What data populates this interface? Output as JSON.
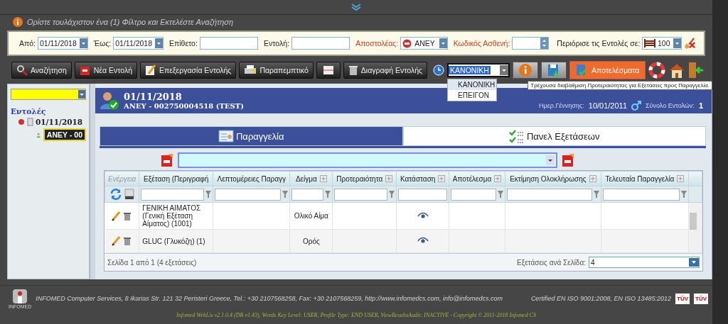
{
  "message": "Ορίστε τουλάχιστον ένα (1) Φίλτρο και Εκτελέστε Αναζήτηση",
  "filters": [
    {
      "kind": "date",
      "label": "Από:",
      "value": "01/11/2018",
      "highlighted": false
    },
    {
      "kind": "date",
      "label": "Έως:",
      "value": "01/11/2018",
      "highlighted": false
    },
    {
      "kind": "text",
      "label": "Επίθετο:",
      "highlighted": false
    },
    {
      "kind": "text",
      "label": "Εντολή:",
      "highlighted": false
    },
    {
      "kind": "select",
      "label": "Αποστολέας:",
      "value": "ΑΝΕΥ",
      "highlighted": true
    },
    {
      "kind": "spinner",
      "label": "Κωδικός Ασθενή:",
      "highlighted": true
    }
  ],
  "limit": {
    "label": "Περιόρισε τις Εντολές σε:",
    "value": "100"
  },
  "toolbar": [
    {
      "kind": "labeled",
      "label": "Αναζήτηση"
    },
    {
      "kind": "labeled",
      "label": "Νέα Εντολή"
    },
    {
      "kind": "labeled",
      "label": "Επεξεργασία Εντολής"
    },
    {
      "kind": "labeled",
      "label": "Παραπεμπτικό"
    },
    {
      "kind": "icon"
    },
    {
      "kind": "labeled",
      "label": "Διαγραφή Εντολής"
    }
  ],
  "priority": {
    "value": "ΚΑΝΟΝΙΚΗ",
    "expanded": true,
    "options": [
      {
        "label": "ΚΑΝΟΝΙΚΗ",
        "selected": true
      },
      {
        "label": "ΕΠΕΙΓΟΝ",
        "selected": false
      }
    ],
    "tooltip": "Τρέχουσα διαβάθμιση Προτεραιότητας για Εξετάσεις προς Παραγγελία."
  },
  "results_button": "Αποτελέσματα",
  "sidebar": {
    "tree": [
      {
        "label": "Εντολές",
        "selected": false,
        "children": [
          {
            "label": "01/11/2018",
            "selected": false,
            "children": [
              {
                "label": "ΑΝΕΥ - 00",
                "selected": true
              }
            ]
          }
        ]
      }
    ]
  },
  "patient": {
    "date": "01/11/2018",
    "name": "ΑΝΕΥ - 002750004518 (TEST)",
    "birth_label": "Ημερ.Γέννησης:",
    "birth_date": "10/01/2011",
    "orders_label": "Σύνολο Εντολών:",
    "orders_count": "1"
  },
  "tabs": [
    {
      "label": "Παραγγελία",
      "selected": true
    },
    {
      "label": "Πανελ Εξετάσεων",
      "selected": false
    }
  ],
  "table": {
    "columns": [
      {
        "label": "Ενέργεια",
        "sortable": false,
        "filterable": false
      },
      {
        "label": "Εξέταση (Περιγραφή",
        "sortable": false,
        "filterable": true
      },
      {
        "label": "Λεπτομέρειες Παραγγ",
        "sortable": false,
        "filterable": true
      },
      {
        "label": "Δείγμα",
        "sortable": true,
        "filterable": true
      },
      {
        "label": "Προτεραιότητα",
        "sortable": true,
        "filterable": true
      },
      {
        "label": "Κατάσταση",
        "sortable": true,
        "filterable": false
      },
      {
        "label": "Αποτέλεσμα",
        "sortable": true,
        "filterable": true
      },
      {
        "label": "Εκτίμηση Ολοκλήρωσης",
        "sortable": true,
        "filterable": true
      },
      {
        "label": "Τελευταία Παραγγελία",
        "sortable": true,
        "filterable": true
      }
    ],
    "rows": [
      {
        "exam": "ΓΕΝΙΚΗ ΑΙΜΑΤΟΣ (Γενική Εξέταση Αίματος) (1001)",
        "sample": "Ολικό Αίμα"
      },
      {
        "exam": "GLUC (Γλυκόζη) (1)",
        "sample": "Ορός"
      }
    ],
    "page_info": "Σελίδα 1 από 1 (4 εξετάσεις)",
    "per_page_label": "Εξετάσεις ανά Σελίδα:",
    "per_page": "4"
  },
  "footer": {
    "logo_text": "INFOMED",
    "company": "INFOMED Computer Services, 8 Ikarias Str. 121 32 Peristeri Greece, Tel.: +30 2107568258, Fax: +30 2107568259, http://www.infomedcs.com, info@infomedcs.com",
    "certification": "Certified EN ISO 9001:2008, EN ISO 13485:2012",
    "badges": [
      "TÜV",
      "TÜV"
    ],
    "version": "Infomed WebLis v2.1.0.4 (DB v1.43), Words Key Level: USER, Profile Type: END USER, ViewResultsAudit: INACTIVE - Copyright © 2011-2018 Infomed CS"
  }
}
